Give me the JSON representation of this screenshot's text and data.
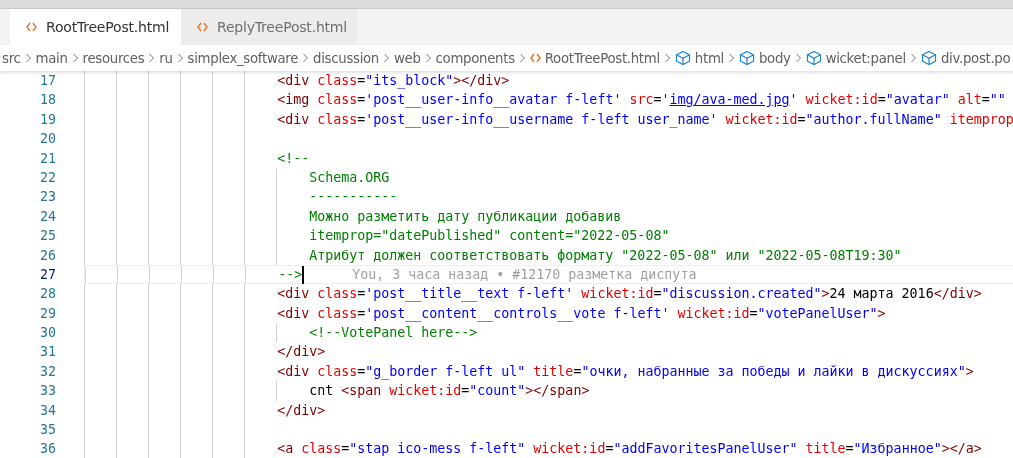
{
  "tabs": [
    {
      "label": "RootTreePost.html",
      "selected": true
    },
    {
      "label": "ReplyTreePost.html",
      "selected": false
    }
  ],
  "breadcrumb": [
    {
      "label": "src",
      "kind": "folder"
    },
    {
      "label": "main",
      "kind": "folder"
    },
    {
      "label": "resources",
      "kind": "folder"
    },
    {
      "label": "ru",
      "kind": "folder"
    },
    {
      "label": "simplex_software",
      "kind": "folder"
    },
    {
      "label": "discussion",
      "kind": "folder"
    },
    {
      "label": "web",
      "kind": "folder"
    },
    {
      "label": "components",
      "kind": "folder"
    },
    {
      "label": "RootTreePost.html",
      "kind": "file"
    },
    {
      "label": "html",
      "kind": "symbol"
    },
    {
      "label": "body",
      "kind": "symbol"
    },
    {
      "label": "wicket:panel",
      "kind": "symbol"
    },
    {
      "label": "div.post.po",
      "kind": "symbol"
    }
  ],
  "editor": {
    "blame": "You, 3 часа назад • #12170 разметка диспута",
    "lines": [
      {
        "number": "17",
        "current": false,
        "tokens": [
          {
            "kind": "tag",
            "text": "                        <div"
          },
          {
            "kind": "attr",
            "text": " class"
          },
          {
            "kind": "plain",
            "text": "="
          },
          {
            "kind": "value",
            "text": "\"its_block\""
          },
          {
            "kind": "tag",
            "text": "></div>"
          }
        ]
      },
      {
        "number": "18",
        "current": false,
        "tokens": [
          {
            "kind": "tag",
            "text": "                        <img"
          },
          {
            "kind": "attr",
            "text": " class"
          },
          {
            "kind": "plain",
            "text": "="
          },
          {
            "kind": "value",
            "text": "'post__user-info__avatar f-left'"
          },
          {
            "kind": "attr",
            "text": " src"
          },
          {
            "kind": "plain",
            "text": "="
          },
          {
            "kind": "value",
            "text": "'"
          },
          {
            "kind": "link",
            "text": "img/ava-med.jpg"
          },
          {
            "kind": "value",
            "text": "'"
          },
          {
            "kind": "attr",
            "text": " wicket:id"
          },
          {
            "kind": "plain",
            "text": "="
          },
          {
            "kind": "value",
            "text": "\"avatar\""
          },
          {
            "kind": "attr",
            "text": " alt"
          },
          {
            "kind": "plain",
            "text": "="
          },
          {
            "kind": "value",
            "text": "\"\""
          }
        ]
      },
      {
        "number": "19",
        "current": false,
        "tokens": [
          {
            "kind": "tag",
            "text": "                        <div"
          },
          {
            "kind": "attr",
            "text": " class"
          },
          {
            "kind": "plain",
            "text": "="
          },
          {
            "kind": "value",
            "text": "'post__user-info__username f-left user_name'"
          },
          {
            "kind": "attr",
            "text": " wicket:id"
          },
          {
            "kind": "plain",
            "text": "="
          },
          {
            "kind": "value",
            "text": "\"author.fullName\""
          },
          {
            "kind": "attr",
            "text": " itemprop"
          }
        ]
      },
      {
        "number": "20",
        "current": false
      },
      {
        "number": "21",
        "current": false,
        "tokens": [
          {
            "kind": "comment",
            "text": "                        <!--"
          }
        ]
      },
      {
        "number": "22",
        "current": false,
        "tokens": [
          {
            "kind": "comment",
            "text": "                            Schema.ORG"
          }
        ]
      },
      {
        "number": "23",
        "current": false,
        "tokens": [
          {
            "kind": "comment",
            "text": "                            -----------"
          }
        ]
      },
      {
        "number": "24",
        "current": false,
        "tokens": [
          {
            "kind": "comment",
            "text": "                            Можно разметить дату публикации добавив"
          }
        ]
      },
      {
        "number": "25",
        "current": false,
        "tokens": [
          {
            "kind": "comment",
            "text": "                            itemprop=\"datePublished\" content=\"2022-05-08\""
          }
        ]
      },
      {
        "number": "26",
        "current": false,
        "tokens": [
          {
            "kind": "comment",
            "text": "                            Атрибут должен соответствовать формату \"2022-05-08\" или \"2022-05-08T19:30\""
          }
        ]
      },
      {
        "number": "27",
        "current": true,
        "tokens": [
          {
            "kind": "comment",
            "text": "                        -->"
          }
        ]
      },
      {
        "number": "28",
        "current": false,
        "tokens": [
          {
            "kind": "tag",
            "text": "                        <div"
          },
          {
            "kind": "attr",
            "text": " class"
          },
          {
            "kind": "plain",
            "text": "="
          },
          {
            "kind": "value",
            "text": "'post__title__text f-left'"
          },
          {
            "kind": "attr",
            "text": " wicket:id"
          },
          {
            "kind": "plain",
            "text": "="
          },
          {
            "kind": "value",
            "text": "\"discussion.created\""
          },
          {
            "kind": "tag",
            "text": ">"
          },
          {
            "kind": "plain",
            "text": "24 марта 2016"
          },
          {
            "kind": "tag",
            "text": "</div>"
          }
        ]
      },
      {
        "number": "29",
        "current": false,
        "tokens": [
          {
            "kind": "tag",
            "text": "                        <div"
          },
          {
            "kind": "attr",
            "text": " class"
          },
          {
            "kind": "plain",
            "text": "="
          },
          {
            "kind": "value",
            "text": "'post__content__controls__vote f-left'"
          },
          {
            "kind": "attr",
            "text": " wicket:id"
          },
          {
            "kind": "plain",
            "text": "="
          },
          {
            "kind": "value",
            "text": "\"votePanelUser\""
          },
          {
            "kind": "tag",
            "text": ">"
          }
        ]
      },
      {
        "number": "30",
        "current": false,
        "tokens": [
          {
            "kind": "comment",
            "text": "                            <!--VotePanel here-->"
          }
        ]
      },
      {
        "number": "31",
        "current": false,
        "tokens": [
          {
            "kind": "tag",
            "text": "                        </div>"
          }
        ]
      },
      {
        "number": "32",
        "current": false,
        "tokens": [
          {
            "kind": "tag",
            "text": "                        <div"
          },
          {
            "kind": "attr",
            "text": " class"
          },
          {
            "kind": "plain",
            "text": "="
          },
          {
            "kind": "value",
            "text": "\"g_border f-left ul\""
          },
          {
            "kind": "attr",
            "text": " title"
          },
          {
            "kind": "plain",
            "text": "="
          },
          {
            "kind": "value",
            "text": "\"очки, набранные за победы и лайки в дискуссиях\""
          },
          {
            "kind": "tag",
            "text": ">"
          }
        ]
      },
      {
        "number": "33",
        "current": false,
        "tokens": [
          {
            "kind": "plain",
            "text": "                            cnt "
          },
          {
            "kind": "tag",
            "text": "<span"
          },
          {
            "kind": "attr",
            "text": " wicket:id"
          },
          {
            "kind": "plain",
            "text": "="
          },
          {
            "kind": "value",
            "text": "\"count\""
          },
          {
            "kind": "tag",
            "text": "></span>"
          }
        ]
      },
      {
        "number": "34",
        "current": false,
        "tokens": [
          {
            "kind": "tag",
            "text": "                        </div>"
          }
        ]
      },
      {
        "number": "35",
        "current": false
      },
      {
        "number": "36",
        "current": false,
        "tokens": [
          {
            "kind": "tag",
            "text": "                        <a"
          },
          {
            "kind": "attr",
            "text": " class"
          },
          {
            "kind": "plain",
            "text": "="
          },
          {
            "kind": "value",
            "text": "\"stap ico-mess f-left\""
          },
          {
            "kind": "attr",
            "text": " wicket:id"
          },
          {
            "kind": "plain",
            "text": "="
          },
          {
            "kind": "value",
            "text": "\"addFavoritesPanelUser\""
          },
          {
            "kind": "attr",
            "text": " title"
          },
          {
            "kind": "plain",
            "text": "="
          },
          {
            "kind": "value",
            "text": "\"Избранное\""
          },
          {
            "kind": "tag",
            "text": "></a>"
          }
        ]
      }
    ]
  }
}
